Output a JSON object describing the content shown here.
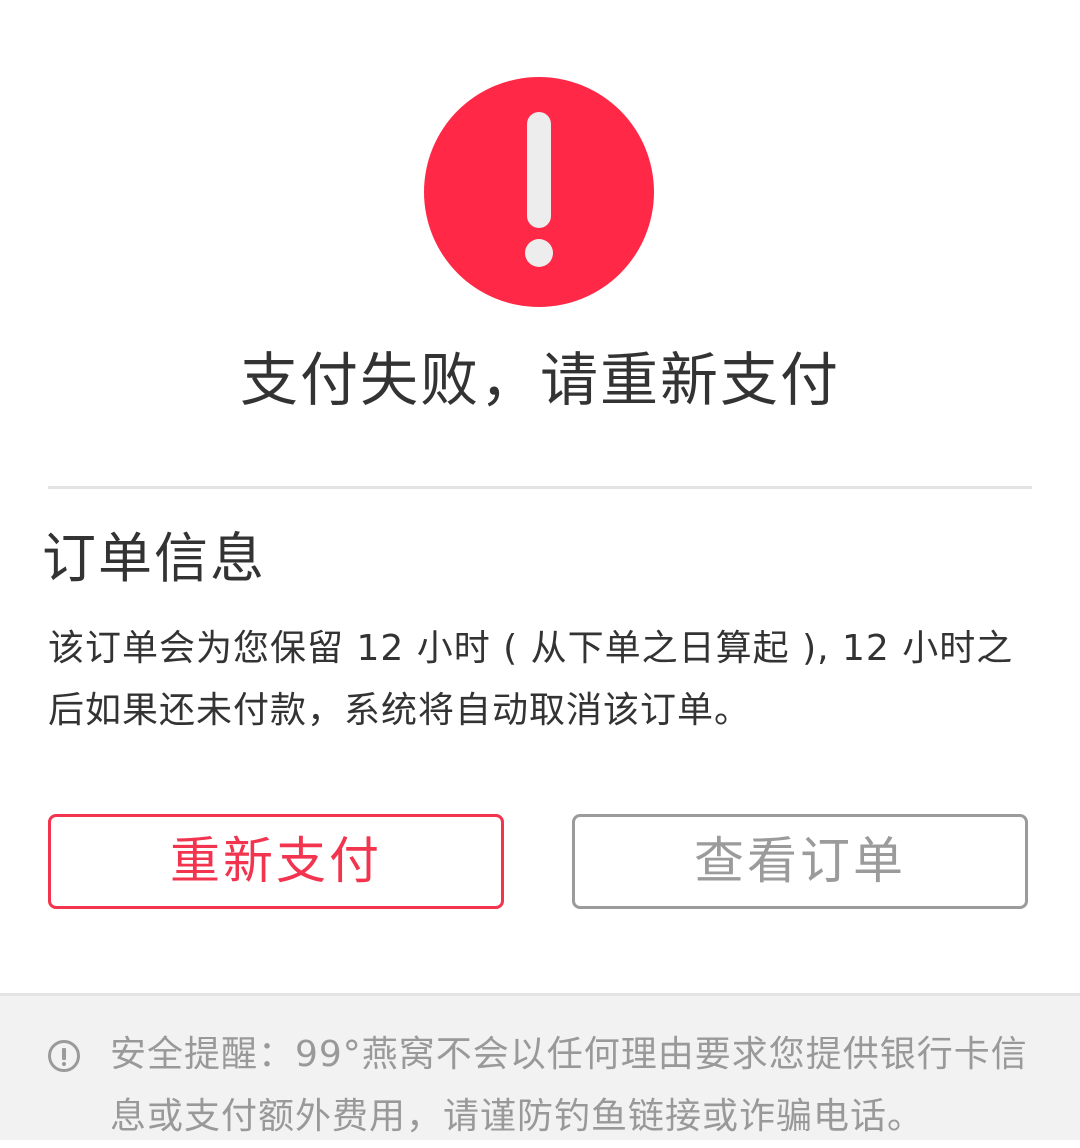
{
  "result": {
    "icon": "exclamation-circle-icon",
    "icon_color": "#ff2846",
    "title": "支付失败，请重新支付"
  },
  "order_info": {
    "title": "订单信息",
    "description": "该订单会为您保留 12 小时 ( 从下单之日算起 ), 12 小时之后如果还未付款，系统将自动取消该订单。"
  },
  "actions": {
    "repay_label": "重新支付",
    "view_order_label": "查看订单",
    "accent_color": "#f2344f"
  },
  "security_notice": {
    "icon": "info-circle-icon",
    "text": "安全提醒：99°燕窝不会以任何理由要求您提供银行卡信息或支付额外费用，请谨防钓鱼链接或诈骗电话。"
  }
}
